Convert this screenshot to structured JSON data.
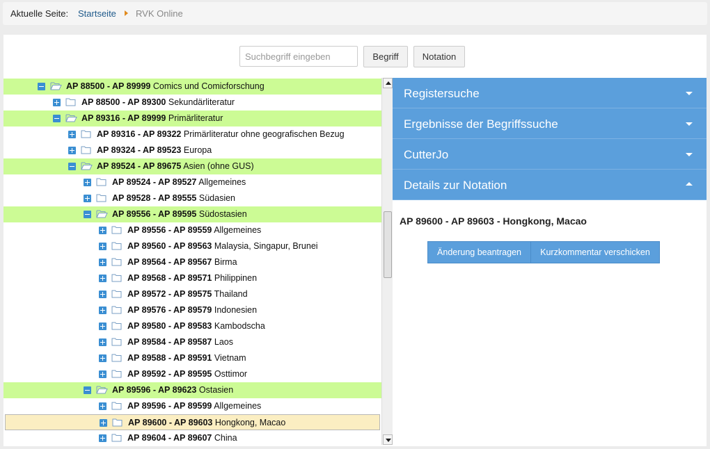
{
  "breadcrumb": {
    "label": "Aktuelle Seite:",
    "home": "Startseite",
    "current": "RVK Online"
  },
  "search": {
    "placeholder": "Suchbegriff eingeben",
    "value": "",
    "begriff_label": "Begriff",
    "notation_label": "Notation"
  },
  "tree": [
    {
      "indent": 0,
      "state": "open",
      "code": "AP 88500 - AP 89999",
      "label": "Comics und Comicforschung"
    },
    {
      "indent": 1,
      "state": "closed",
      "code": "AP 88500 - AP 89300",
      "label": "Sekundärliteratur"
    },
    {
      "indent": 1,
      "state": "open",
      "code": "AP 89316 - AP 89999",
      "label": "Primärliteratur"
    },
    {
      "indent": 2,
      "state": "closed",
      "code": "AP 89316 - AP 89322",
      "label": "Primärliteratur ohne geografischen Bezug"
    },
    {
      "indent": 2,
      "state": "closed",
      "code": "AP 89324 - AP 89523",
      "label": "Europa"
    },
    {
      "indent": 2,
      "state": "open",
      "code": "AP 89524 - AP 89675",
      "label": "Asien (ohne GUS)"
    },
    {
      "indent": 3,
      "state": "closed",
      "code": "AP 89524 - AP 89527",
      "label": "Allgemeines"
    },
    {
      "indent": 3,
      "state": "closed",
      "code": "AP 89528 - AP 89555",
      "label": "Südasien"
    },
    {
      "indent": 3,
      "state": "open",
      "code": "AP 89556 - AP 89595",
      "label": "Südostasien"
    },
    {
      "indent": 4,
      "state": "closed",
      "code": "AP 89556 - AP 89559",
      "label": "Allgemeines"
    },
    {
      "indent": 4,
      "state": "closed",
      "code": "AP 89560 - AP 89563",
      "label": "Malaysia, Singapur, Brunei"
    },
    {
      "indent": 4,
      "state": "closed",
      "code": "AP 89564 - AP 89567",
      "label": "Birma"
    },
    {
      "indent": 4,
      "state": "closed",
      "code": "AP 89568 - AP 89571",
      "label": "Philippinen"
    },
    {
      "indent": 4,
      "state": "closed",
      "code": "AP 89572 - AP 89575",
      "label": "Thailand"
    },
    {
      "indent": 4,
      "state": "closed",
      "code": "AP 89576 - AP 89579",
      "label": "Indonesien"
    },
    {
      "indent": 4,
      "state": "closed",
      "code": "AP 89580 - AP 89583",
      "label": "Kambodscha"
    },
    {
      "indent": 4,
      "state": "closed",
      "code": "AP 89584 - AP 89587",
      "label": "Laos"
    },
    {
      "indent": 4,
      "state": "closed",
      "code": "AP 89588 - AP 89591",
      "label": "Vietnam"
    },
    {
      "indent": 4,
      "state": "closed",
      "code": "AP 89592 - AP 89595",
      "label": "Osttimor"
    },
    {
      "indent": 3,
      "state": "open",
      "code": "AP 89596 - AP 89623",
      "label": "Ostasien"
    },
    {
      "indent": 4,
      "state": "closed",
      "code": "AP 89596 - AP 89599",
      "label": "Allgemeines"
    },
    {
      "indent": 4,
      "state": "closed",
      "selected": true,
      "code": "AP 89600 - AP 89603",
      "label": "Hongkong, Macao"
    },
    {
      "indent": 4,
      "state": "closed",
      "code": "AP 89604 - AP 89607",
      "label": "China"
    }
  ],
  "accordion": [
    {
      "label": "Registersuche",
      "expanded": false
    },
    {
      "label": "Ergebnisse der Begriffssuche",
      "expanded": false
    },
    {
      "label": "CutterJo",
      "expanded": false
    },
    {
      "label": "Details zur Notation",
      "expanded": true
    }
  ],
  "details": {
    "title": "AP 89600 - AP 89603 - Hongkong, Macao",
    "aenderung_label": "Änderung beantragen",
    "kommentar_label": "Kurzkommentar verschicken"
  },
  "colors": {
    "open_row": "#ccfb95",
    "selected_row": "#fbeec2",
    "accent": "#5b9fdc",
    "toggle": "#3a8ed2"
  }
}
